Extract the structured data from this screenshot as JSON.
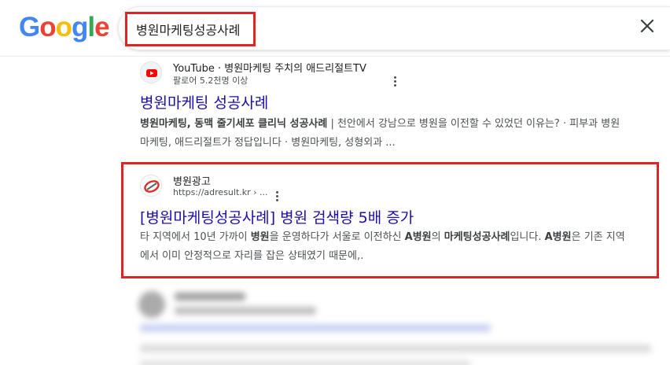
{
  "logo": {
    "letters": [
      "G",
      "o",
      "o",
      "g",
      "l",
      "e"
    ]
  },
  "colors": {
    "accent_red": "#e02424",
    "link_blue": "#1a0dab",
    "blurred_link": "#b6c3f0"
  },
  "search": {
    "query": "병원마케팅성공사례"
  },
  "results": [
    {
      "site_name": "YouTube · 병원마케팅 주치의 애드리절트TV",
      "site_sub": "팔로어 5.2천명 이상",
      "title": "병원마케팅 성공사례",
      "snippet_line1_bold": "병원마케팅, 동맥 줄기세포 클리닉 성공사례",
      "snippet_line1_rest": " | 천안에서 강남으로 병원을 이전할 수 있었던 이유는? · 피부과 병원",
      "snippet_line2": "마케팅, 애드리절트가 정답입니다 · 병원마케팅, 성형외과 ..."
    },
    {
      "site_name": "병원광고",
      "site_sub": "https://adresult.kr › ...",
      "title": "[병원마케팅성공사례] 병원 검색량 5배 증가",
      "snippet_a": "타 지역에서 10년 가까이 ",
      "snippet_b": "병원",
      "snippet_c": "을 운영하다가 서울로 이전하신 ",
      "snippet_d": "A병원",
      "snippet_e": "의 ",
      "snippet_f": "마케팅성공사례",
      "snippet_g": "입니다. ",
      "snippet_h": "A병원",
      "snippet_i": "은 기존 지역",
      "snippet_line2": "에서 이미 안정적으로 자리를 잡은 상태였기 때문에,."
    }
  ]
}
